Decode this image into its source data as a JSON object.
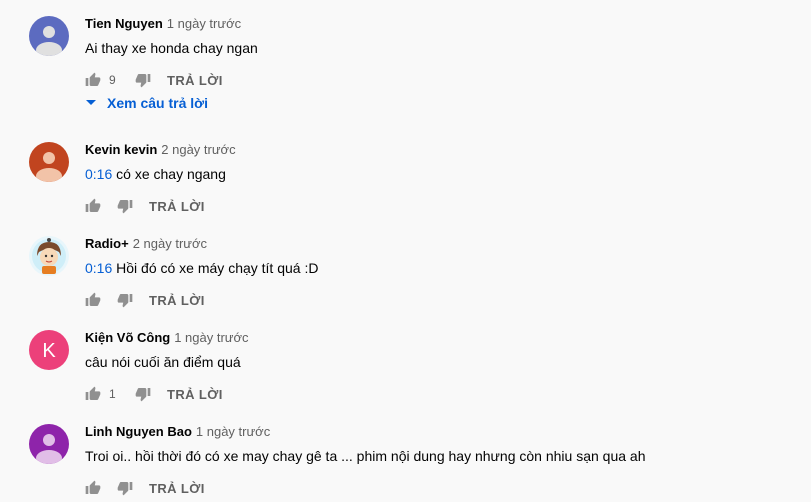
{
  "reply_label": "TRẢ LỜI",
  "view_replies_label": "Xem câu trả lời",
  "colors": {
    "link": "#065fd4",
    "muted": "#606060",
    "icon": "#909090"
  },
  "comments": [
    {
      "author": "Tien Nguyen",
      "time": "1 ngày trước",
      "timestamp": "",
      "text": "Ai thay xe honda chay ngan",
      "likes": "9",
      "avatar": {
        "type": "person",
        "bg": "#5c6bc0"
      }
    },
    {
      "author": "Kevin kevin",
      "time": "2 ngày trước",
      "timestamp": "0:16",
      "text": " có xe chay ngang",
      "likes": "",
      "avatar": {
        "type": "person",
        "bg": "#c1441f"
      }
    },
    {
      "author": "Radio+",
      "time": "2 ngày trước",
      "timestamp": "0:16",
      "text": " Hồi đó có xe máy chạy tít quá :D",
      "likes": "",
      "avatar": {
        "type": "cartoon",
        "bg": "#e8f6fb"
      }
    },
    {
      "author": "Kiện Võ Công",
      "time": "1 ngày trước",
      "timestamp": "",
      "text": "câu nói cuối ăn điểm quá",
      "likes": "1",
      "avatar": {
        "type": "letter",
        "letter": "K",
        "bg": "#ec407a"
      }
    },
    {
      "author": "Linh Nguyen Bao",
      "time": "1 ngày trước",
      "timestamp": "",
      "text": "Troi oi.. hồi thời đó có xe may chay gê ta ... phim nội dung hay nhưng còn nhiu sạn qua ah",
      "likes": "",
      "avatar": {
        "type": "person",
        "bg": "#8e24aa"
      }
    }
  ]
}
